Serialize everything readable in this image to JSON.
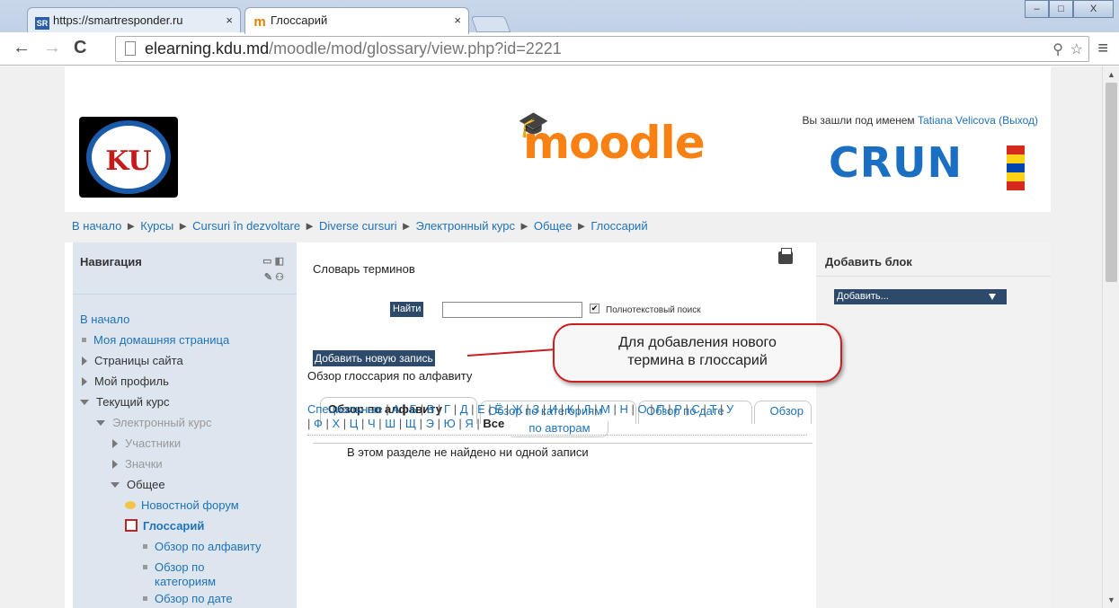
{
  "browser": {
    "tabs": [
      {
        "favicon": "SR",
        "title": "https://smartresponder.ru",
        "close": "×",
        "active": false
      },
      {
        "favicon": "m",
        "title": "Глоссарий",
        "close": "×",
        "active": true
      }
    ],
    "url_host": "elearning.kdu.md",
    "url_path": "/moodle/mod/glossary/view.php?id=2221",
    "window_buttons": [
      "–",
      "□",
      "X"
    ]
  },
  "header": {
    "login_prefix": "Вы зашли под именем",
    "user_name": "Tatiana Velicova",
    "logout": "(Выход)",
    "moodle_logo_text": "moodle",
    "kdu_logo_text": "KU",
    "crunt_logo_text": "CRUN"
  },
  "breadcrumbs": [
    "В начало",
    "Курсы",
    "Cursuri în dezvoltare",
    "Diverse cursuri",
    "Электронный курс",
    "Общее",
    "Глоссарий"
  ],
  "breadcrumb_separator": "►",
  "navigation": {
    "title": "Навигация",
    "items": [
      {
        "label": "В начало",
        "type": "link"
      },
      {
        "label": "Моя домашняя страница",
        "type": "bullet"
      },
      {
        "label": "Страницы сайта",
        "type": "collapsed"
      },
      {
        "label": "Мой профиль",
        "type": "collapsed"
      },
      {
        "label": "Текущий курс",
        "type": "expanded"
      },
      {
        "label": "Электронный курс",
        "type": "expanded-muted"
      },
      {
        "label": "Участники",
        "type": "collapsed-muted"
      },
      {
        "label": "Значки",
        "type": "collapsed-muted"
      },
      {
        "label": "Общее",
        "type": "expanded"
      },
      {
        "label": "Новостной форум",
        "type": "forum"
      },
      {
        "label": "Глоссарий",
        "type": "glossary"
      },
      {
        "label": "Обзор по алфавиту",
        "type": "bullet"
      },
      {
        "label": "Обзор по",
        "type": "bullet"
      },
      {
        "label": "категориям",
        "type": "cont"
      },
      {
        "label": "Обзор по дате",
        "type": "bullet"
      }
    ]
  },
  "main": {
    "title": "Словарь терминов",
    "search_button": "Найти",
    "search_value": "",
    "fulltext_label": "Полнотекстовый поиск",
    "fulltext_checked": true,
    "add_entry": "Добавить новую запись",
    "callout": [
      "Для добавления нового",
      "термина  в глоссарий"
    ],
    "tabs": [
      "Обзор по алфавиту",
      "Обзор по категориям",
      "Обзор по дате",
      "Обзор",
      "по авторам"
    ],
    "section_title": "Обзор глоссария по алфавиту",
    "alphabet_line1": [
      "Специальные",
      "А",
      "Б",
      "В",
      "Г",
      "Д",
      "Е",
      "Ё",
      "Ж",
      "З",
      "И",
      "К",
      "Л",
      "М",
      "Н",
      "О",
      "П",
      "Р",
      "С",
      "Т",
      "У"
    ],
    "alphabet_line2": [
      "Ф",
      "Х",
      "Ц",
      "Ч",
      "Ш",
      "Щ",
      "Э",
      "Ю",
      "Я"
    ],
    "alphabet_all": "Все",
    "empty_message": "В этом разделе не найдено ни одной записи"
  },
  "right_block": {
    "title": "Добавить блок",
    "select_value": "Добавить..."
  },
  "colors": {
    "link": "#1f72b8",
    "dark_button": "#2e4a6b",
    "callout_border": "#c82020",
    "moodle_orange": "#f98012"
  }
}
